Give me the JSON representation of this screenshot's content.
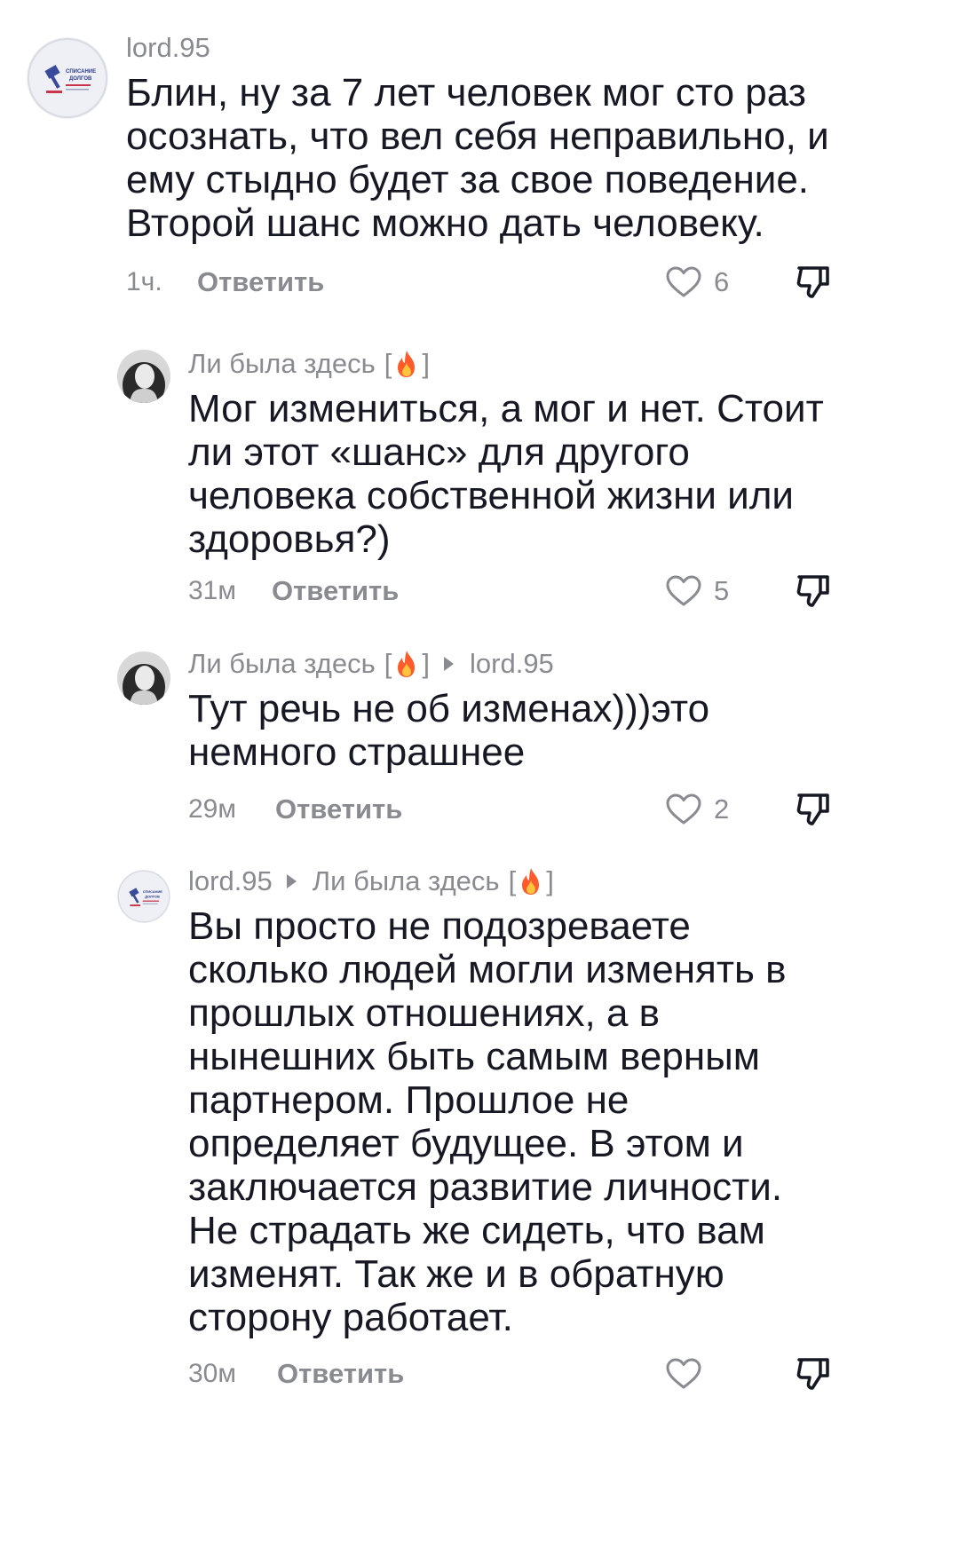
{
  "comments": [
    {
      "username": "lord.95",
      "avatar_text": [
        "СПИСАНИЕ",
        "ДОЛГОВ"
      ],
      "lines": [
        "Блин, ну за 7 лет человек мог сто раз",
        "осознать, что вел себя неправильно, и",
        "ему стыдно будет за свое поведение.",
        "Второй шанс можно дать человеку."
      ],
      "time": "1ч.",
      "reply_label": "Ответить",
      "likes": "6"
    },
    {
      "username": "Ли была здесь",
      "lines": [
        "Мог измениться, а мог и нет. Стоит",
        "ли этот «шанс» для другого",
        "человека собственной жизни или",
        "здоровья?)"
      ],
      "time": "31м",
      "reply_label": "Ответить",
      "likes": "5"
    },
    {
      "username": "Ли была здесь",
      "reply_to": "lord.95",
      "lines": [
        "Тут речь не об изменах)))это",
        "немного страшнее"
      ],
      "time": "29м",
      "reply_label": "Ответить",
      "likes": "2"
    },
    {
      "username": "lord.95",
      "reply_to": "Ли была здесь",
      "avatar_text": [
        "СПИСАНИЕ",
        "ДОЛГОВ"
      ],
      "lines": [
        "Вы просто не подозреваете",
        "сколько людей могли изменять в",
        "прошлых отношениях, а в",
        "нынешних быть самым верным",
        "партнером. Прошлое не",
        "определяет будущее. В этом и",
        "заключается развитие личности.",
        "Не страдать же сидеть, что вам",
        "изменят. Так же и в обратную",
        "сторону работает."
      ],
      "time": "30м",
      "reply_label": "Ответить"
    }
  ],
  "flair_bracket_open": "[",
  "flair_bracket_close": "]",
  "colors": {
    "text": "#161823",
    "muted": "#8a8b91",
    "flame": "#fe5a2c"
  },
  "icons": {
    "like": "heart-outline-icon",
    "dislike": "thumbs-down-icon",
    "flair": "fire-icon",
    "reply_to": "triangle-right-icon"
  }
}
